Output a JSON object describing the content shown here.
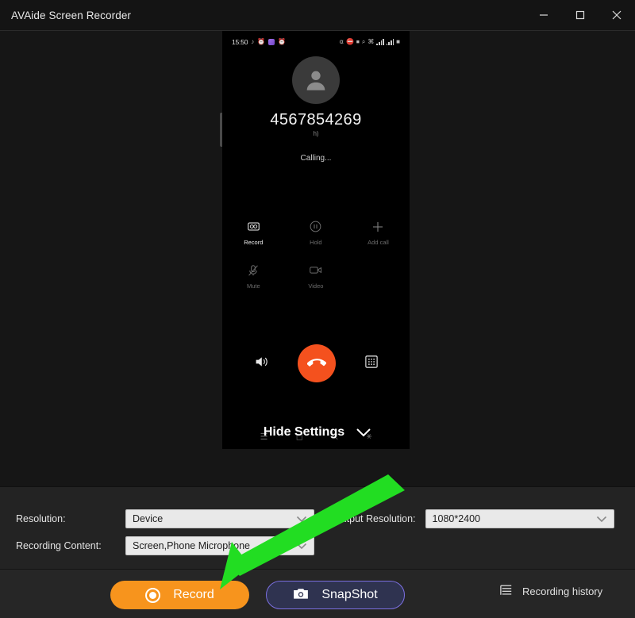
{
  "window": {
    "title": "AVAide Screen Recorder",
    "minimize_label": "—",
    "maximize_label": "☐",
    "close_label": "✕"
  },
  "phone": {
    "status_bar": {
      "clock": "15:50",
      "left_icons": [
        "music-note-icon",
        "alarm-off-icon",
        "gallery-icon",
        "clock-icon"
      ],
      "right_icons": [
        "headphone-icon",
        "dnd-icon",
        "volume-icon",
        "wifi-off-icon",
        "vpn-icon",
        "signal-1-icon",
        "signal-2-icon",
        "battery-icon"
      ]
    },
    "avatar_icon": "person-avatar-icon",
    "call_number": "4567854269",
    "call_subtitle": "h)",
    "call_status": "Calling...",
    "controls": [
      {
        "label": "Record",
        "icon": "record-call-icon",
        "active": true
      },
      {
        "label": "Hold",
        "icon": "pause-icon",
        "active": false
      },
      {
        "label": "Add call",
        "icon": "plus-icon",
        "active": false
      },
      {
        "label": "Mute",
        "icon": "mic-off-icon",
        "active": false
      },
      {
        "label": "Video",
        "icon": "video-camera-icon",
        "active": false
      }
    ],
    "call_bar": {
      "speaker_icon": "speaker-icon",
      "end_call_icon": "end-call-handset-icon",
      "keypad_icon": "keypad-icon",
      "end_call_color": "#f4511e"
    },
    "nav_bar": [
      "recents-icon",
      "home-icon",
      "back-share-icon",
      "accessibility-icon"
    ]
  },
  "settings_toggle": {
    "label": "Hide Settings",
    "chevron_icon": "chevron-down-icon"
  },
  "settings": {
    "resolution": {
      "label": "Resolution:",
      "value": "Device",
      "caret_icon": "chevron-down-icon"
    },
    "recording_content": {
      "label": "Recording Content:",
      "value": "Screen,Phone Microphone",
      "caret_icon": "chevron-down-icon"
    },
    "output_resolution": {
      "label": "Output Resolution:",
      "value": "1080*2400",
      "caret_icon": "chevron-down-icon"
    }
  },
  "bottom_bar": {
    "record_button": {
      "label": "Record",
      "icon": "record-dot-icon",
      "color": "#f7941d"
    },
    "snapshot_button": {
      "label": "SnapShot",
      "icon": "camera-icon",
      "border_color": "#7b6fe0"
    },
    "recording_history": {
      "label": "Recording history",
      "icon": "list-icon"
    }
  },
  "annotation": {
    "arrow_color": "#22dd22",
    "arrow_from": "Hide Settings",
    "arrow_to": "Record button"
  }
}
